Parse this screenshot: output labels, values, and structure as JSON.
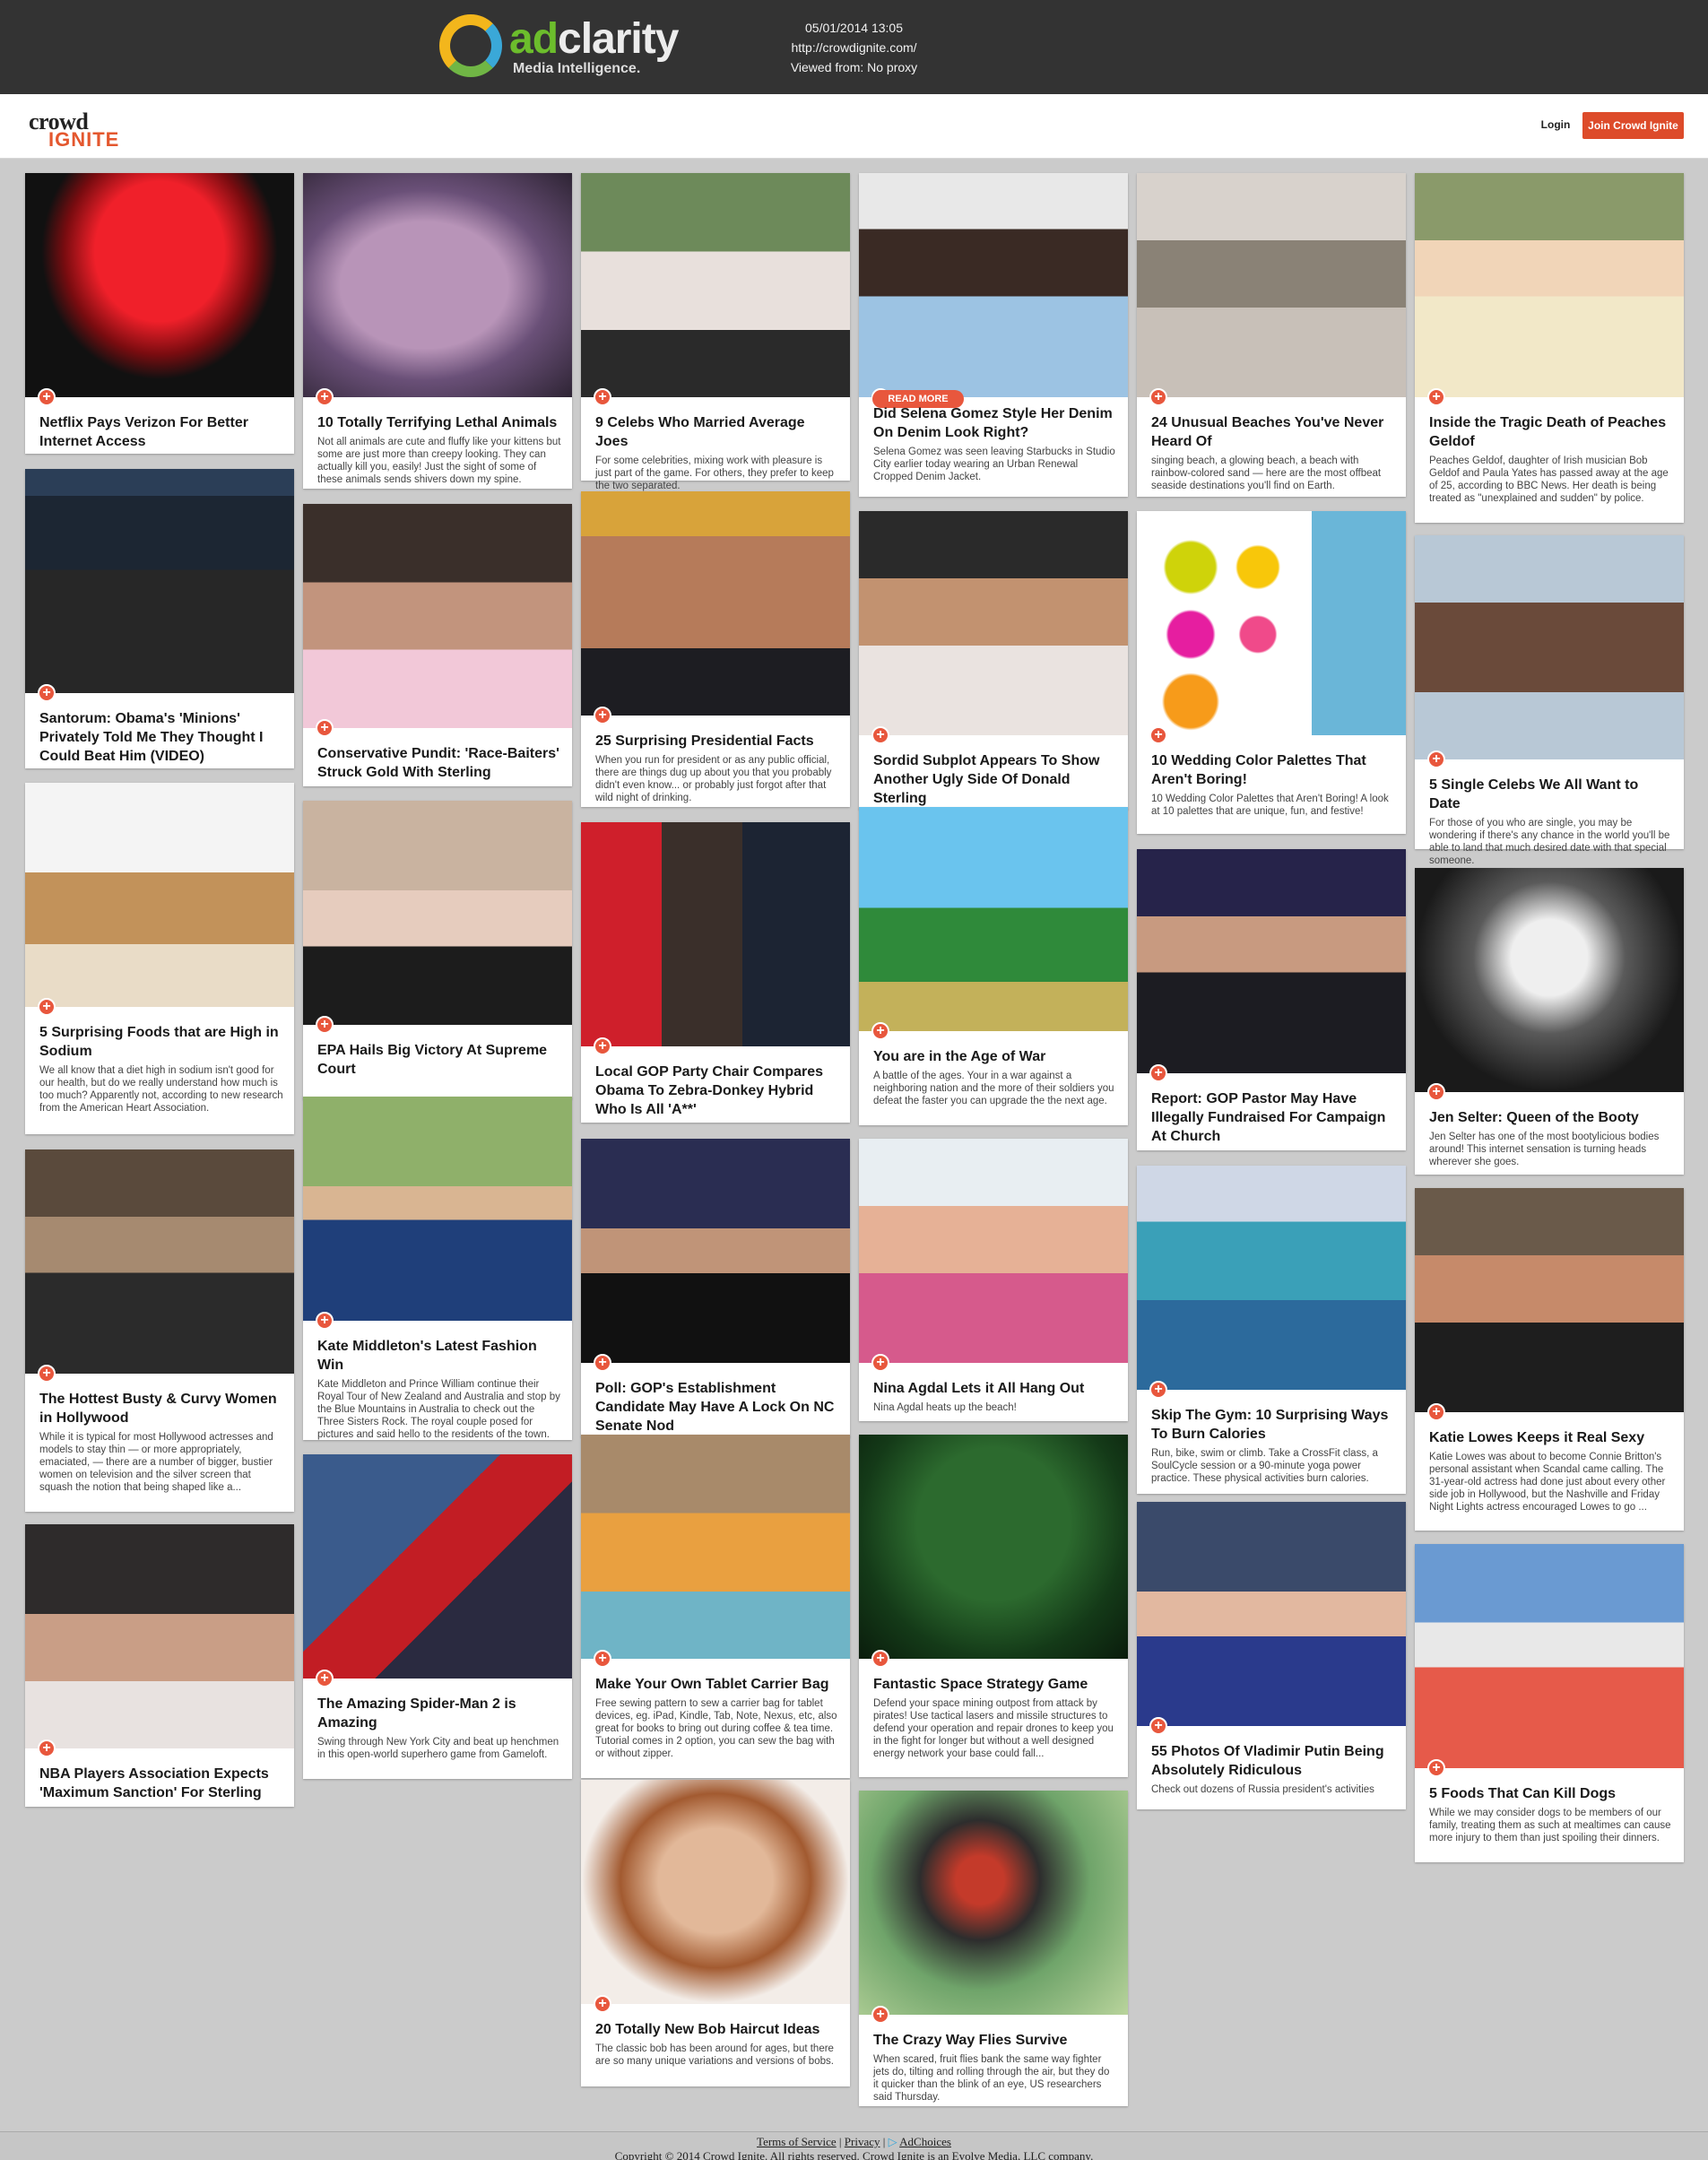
{
  "adbar": {
    "logo_brand_part1": "ad",
    "logo_brand_part2": "clarity",
    "logo_tagline": "Media Intelligence.",
    "timestamp": "05/01/2014 13:05",
    "url": "http://crowdignite.com/",
    "viewed_from": "Viewed from: No proxy"
  },
  "header": {
    "brand_line1": "crowd",
    "brand_line2": "IGNITE",
    "login_label": "Login",
    "join_label": "Join Crowd Ignite"
  },
  "colors": {
    "accent": "#e8573d",
    "topbar": "#333333",
    "background": "#cbcbcb"
  },
  "cards": [
    {
      "title": "Netflix Pays Verizon For Better Internet Access",
      "desc": "",
      "read_more": ""
    },
    {
      "title": "Santorum: Obama's 'Minions' Privately Told Me They Thought I Could Beat Him (VIDEO)",
      "desc": "",
      "read_more": ""
    },
    {
      "title": "5 Surprising Foods that are High in Sodium",
      "desc": "We all know that a diet high in sodium isn't good for our health, but do we really understand how much is too much? Apparently not, according to new research from the American Heart Association.",
      "read_more": ""
    },
    {
      "title": "The Hottest Busty & Curvy Women in Hollywood",
      "desc": "While it is typical for most Hollywood actresses and models to stay thin — or more appropriately, emaciated, — there are a number of bigger, bustier women on television and the silver screen that squash the notion that being shaped like a...",
      "read_more": ""
    },
    {
      "title": "NBA Players Association Expects 'Maximum Sanction' For Sterling",
      "desc": "",
      "read_more": ""
    },
    {
      "title": "10 Totally Terrifying Lethal Animals",
      "desc": "Not all animals are cute and fluffy like your kittens but some are just more than creepy looking. They can actually kill you, easily! Just the sight of some of these animals sends shivers down my spine.",
      "read_more": ""
    },
    {
      "title": "Conservative Pundit: 'Race-Baiters' Struck Gold With Sterling",
      "desc": "",
      "read_more": ""
    },
    {
      "title": "EPA Hails Big Victory At Supreme Court",
      "desc": "",
      "read_more": ""
    },
    {
      "title": "Kate Middleton's Latest Fashion Win",
      "desc": "Kate Middleton and Prince William continue their Royal Tour of New Zealand and Australia and stop by the Blue Mountains in Australia to check out the Three Sisters Rock. The royal couple posed for pictures and said hello to the residents of the town.",
      "read_more": ""
    },
    {
      "title": "The Amazing Spider-Man 2 is Amazing",
      "desc": "Swing through New York City and beat up henchmen in this open-world superhero game from Gameloft.",
      "read_more": ""
    },
    {
      "title": "9 Celebs Who Married Average Joes",
      "desc": "For some celebrities, mixing work with pleasure is just part of the game. For others, they prefer to keep the two separated.",
      "read_more": ""
    },
    {
      "title": "25 Surprising Presidential Facts",
      "desc": "When you run for president or as any public official, there are things dug up about you that you probably didn't even know... or probably just forgot after that wild night of drinking.",
      "read_more": ""
    },
    {
      "title": "Local GOP Party Chair Compares Obama To Zebra-Donkey Hybrid Who Is All 'A**'",
      "desc": "",
      "read_more": ""
    },
    {
      "title": "Poll: GOP's Establishment Candidate May Have A Lock On NC Senate Nod",
      "desc": "",
      "read_more": ""
    },
    {
      "title": "Make Your Own Tablet Carrier Bag",
      "desc": "Free sewing pattern to sew a carrier bag for tablet devices, eg. iPad, Kindle, Tab, Note, Nexus, etc, also great for books to bring out during coffee & tea time. Tutorial comes in 2 option, you can sew the bag with or without zipper.",
      "read_more": ""
    },
    {
      "title": "20 Totally New Bob Haircut Ideas",
      "desc": "The classic bob has been around for ages, but there are so many unique variations and versions of bobs.",
      "read_more": ""
    },
    {
      "title": "Did Selena Gomez Style Her Denim On Denim Look Right?",
      "desc": "Selena Gomez was seen leaving Starbucks in Studio City earlier today wearing an Urban Renewal Cropped Denim Jacket.",
      "read_more": "READ MORE"
    },
    {
      "title": "Sordid Subplot Appears To Show Another Ugly Side Of Donald Sterling",
      "desc": "",
      "read_more": ""
    },
    {
      "title": "You are in the Age of War",
      "desc": "A battle of the ages. Your in a war against a neighboring nation and the more of their soldiers you defeat the faster you can upgrade the the next age.",
      "read_more": ""
    },
    {
      "title": "Nina Agdal Lets it All Hang Out",
      "desc": "Nina Agdal heats up the beach!",
      "read_more": ""
    },
    {
      "title": "Fantastic Space Strategy Game",
      "desc": "Defend your space mining outpost from attack by pirates! Use tactical lasers and missile structures to defend your operation and repair drones to keep you in the fight for longer but without a well designed energy network your base could fall...",
      "read_more": ""
    },
    {
      "title": "The Crazy Way Flies Survive",
      "desc": "When scared, fruit flies bank the same way fighter jets do, tilting and rolling through the air, but they do it quicker than the blink of an eye, US researchers said Thursday.",
      "read_more": ""
    },
    {
      "title": "24 Unusual Beaches You've Never Heard Of",
      "desc": "singing beach, a glowing beach, a beach with rainbow-colored sand — here are the most offbeat seaside destinations you'll find on Earth.",
      "read_more": ""
    },
    {
      "title": "10 Wedding Color Palettes That Aren't Boring!",
      "desc": "10 Wedding Color Palettes that Aren't Boring! A look at 10 palettes that are unique, fun, and festive!",
      "read_more": ""
    },
    {
      "title": "Report: GOP Pastor May Have Illegally Fundraised For Campaign At Church",
      "desc": "",
      "read_more": ""
    },
    {
      "title": "Skip The Gym: 10 Surprising Ways To Burn Calories",
      "desc": "Run, bike, swim or climb. Take a CrossFit class, a SoulCycle session or a 90-minute yoga power practice. These physical activities burn calories.",
      "read_more": ""
    },
    {
      "title": "55 Photos Of Vladimir Putin Being Absolutely Ridiculous",
      "desc": "Check out dozens of Russia president's activities",
      "read_more": ""
    },
    {
      "title": "Inside the Tragic Death of Peaches Geldof",
      "desc": "Peaches Geldof, daughter of Irish musician Bob Geldof and Paula Yates has passed away at the age of 25, according to BBC News. Her death is being treated as \"unexplained and sudden\" by police.",
      "read_more": ""
    },
    {
      "title": "5 Single Celebs We All Want to Date",
      "desc": "For those of you who are single, you may be wondering if there's any chance in the world you'll be able to land that much desired date with that special someone.",
      "read_more": ""
    },
    {
      "title": "Jen Selter: Queen of the Booty",
      "desc": "Jen Selter has one of the most bootylicious bodies around! This internet sensation is turning heads wherever she goes.",
      "read_more": ""
    },
    {
      "title": "Katie Lowes Keeps it Real Sexy",
      "desc": "Katie Lowes was about to become Connie Britton's personal assistant when Scandal came calling. The 31-year-old actress had done just about every other side job in Hollywood, but the Nashville and Friday Night Lights actress encouraged Lowes to go ...",
      "read_more": ""
    },
    {
      "title": "5 Foods That Can Kill Dogs",
      "desc": "While we may consider dogs to be members of our family, treating them as such at mealtimes can cause more injury to them than just spoiling their dinners.",
      "read_more": ""
    }
  ],
  "footer": {
    "terms": "Terms of Service",
    "sep1": "|",
    "privacy": "Privacy",
    "sep2": "|",
    "adchoices": "AdChoices",
    "copyright": "Copyright © 2014 Crowd Ignite. All rights reserved. Crowd Ignite is an Evolve Media, LLC company."
  }
}
